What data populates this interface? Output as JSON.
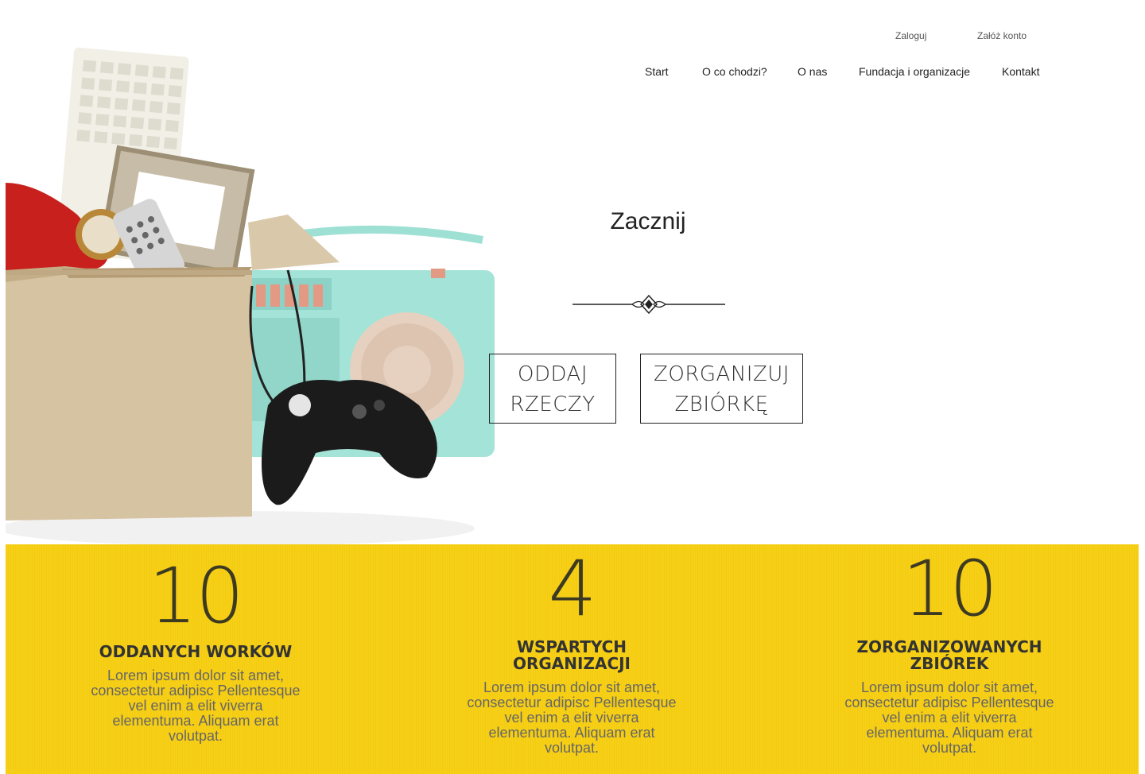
{
  "auth": {
    "login": "Zaloguj",
    "register": "Załóż konto"
  },
  "nav": {
    "items": [
      {
        "label": "Start"
      },
      {
        "label": "O co chodzi?"
      },
      {
        "label": "O nas"
      },
      {
        "label": "Fundacja i organizacje"
      },
      {
        "label": "Kontakt"
      }
    ]
  },
  "hero": {
    "title": "Zacznij",
    "buttons": {
      "give_line1": "ODDAJ",
      "give_line2": "RZECZY",
      "organize_line1": "ZORGANIZUJ",
      "organize_line2": "ZBIÓRKĘ"
    }
  },
  "stats": [
    {
      "number": "10",
      "label_line1": "ODDANYCH WORKÓW",
      "label_line2": "",
      "description": "Lorem ipsum dolor sit amet, consectetur adipisc Pellentesque vel enim a elit viverra elementuma. Aliquam erat volutpat."
    },
    {
      "number": "4",
      "label_line1": "WSPARTYCH",
      "label_line2": "ORGANIZACJI",
      "description": "Lorem ipsum dolor sit amet, consectetur adipisc Pellentesque vel enim a elit viverra elementuma. Aliquam erat volutpat."
    },
    {
      "number": "10",
      "label_line1": "ZORGANIZOWANYCH",
      "label_line2": "ZBIÓREK",
      "description": "Lorem ipsum dolor sit amet, consectetur adipisc Pellentesque vel enim a elit viverra elementuma. Aliquam erat volutpat."
    }
  ],
  "colors": {
    "stats_background": "#f7cf15",
    "text_dark": "#222222",
    "number_color": "#3d3a22"
  }
}
